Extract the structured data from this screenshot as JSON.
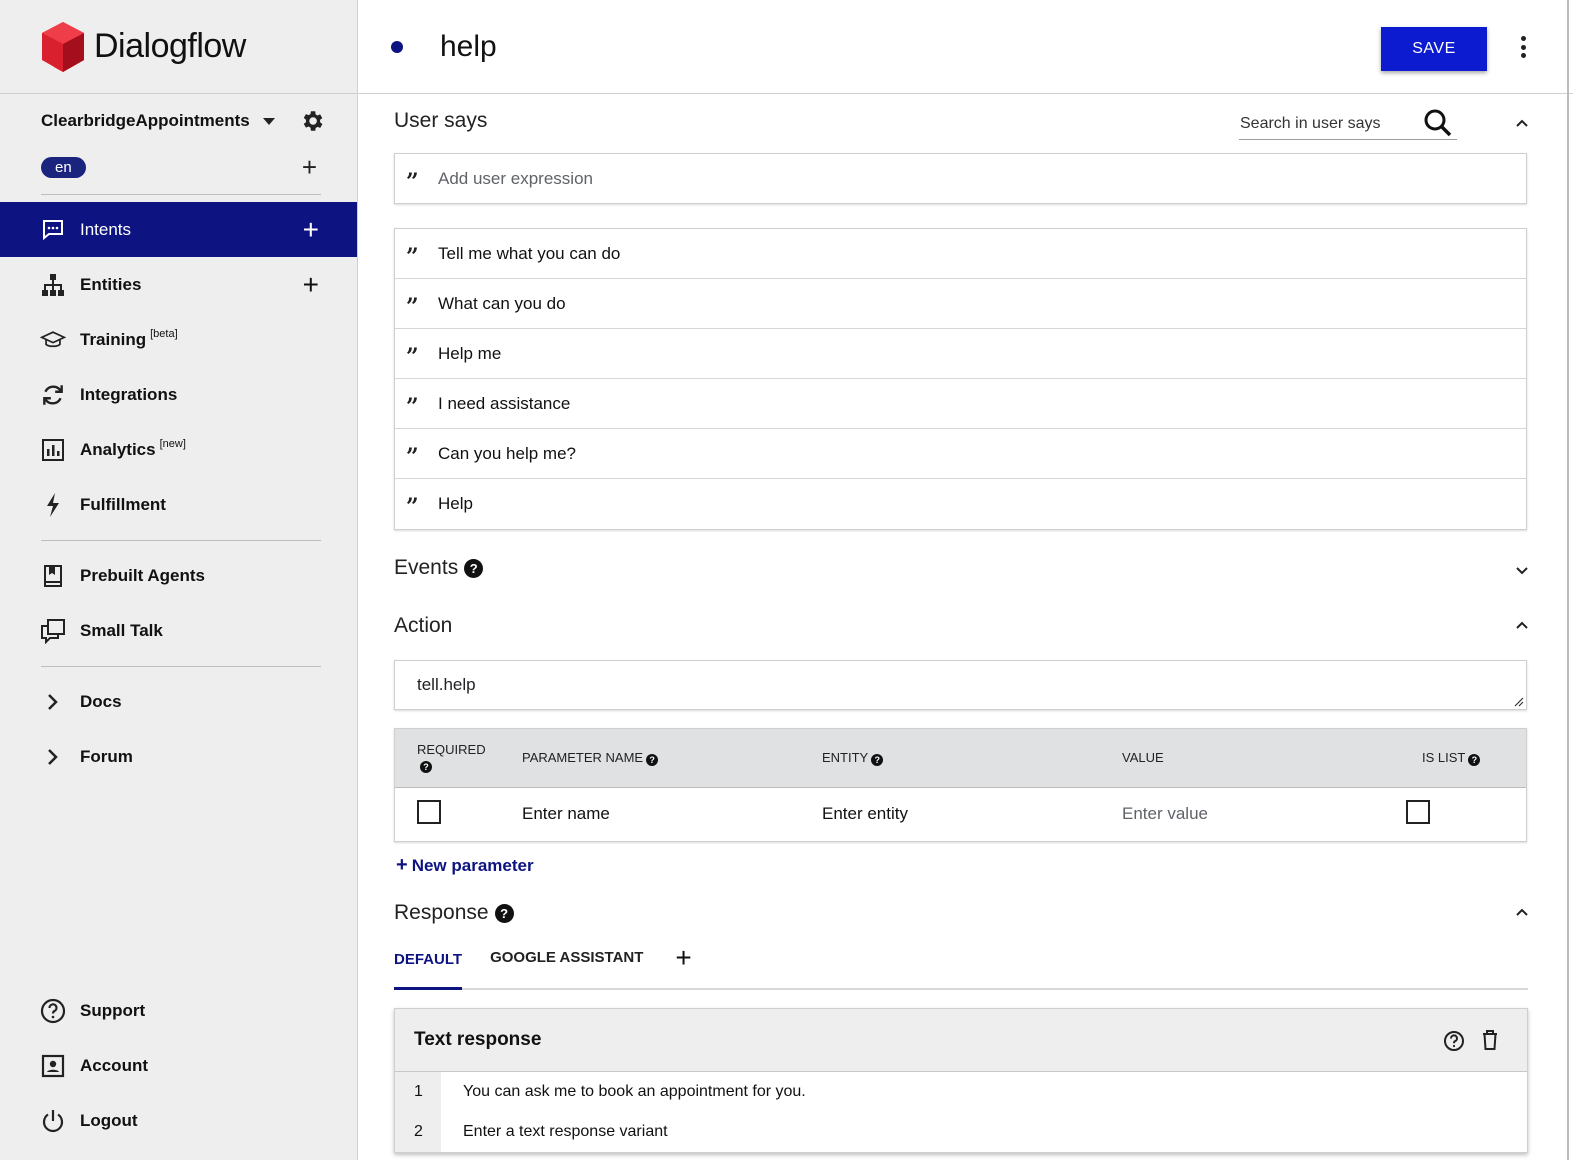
{
  "app": {
    "name": "Dialogflow"
  },
  "agent": {
    "name": "ClearbridgeAppointments",
    "language": "en"
  },
  "nav": {
    "items": [
      {
        "label": "Intents",
        "sup": "",
        "icon": "chat-bubble-icon"
      },
      {
        "label": "Entities",
        "sup": "",
        "icon": "hierarchy-icon"
      },
      {
        "label": "Training",
        "sup": "[beta]",
        "icon": "graduation-cap-icon"
      },
      {
        "label": "Integrations",
        "sup": "",
        "icon": "refresh-icon"
      },
      {
        "label": "Analytics",
        "sup": "[new]",
        "icon": "bar-chart-icon"
      },
      {
        "label": "Fulfillment",
        "sup": "",
        "icon": "bolt-icon"
      },
      {
        "label": "Prebuilt Agents",
        "sup": "",
        "icon": "book-icon"
      },
      {
        "label": "Small Talk",
        "sup": "",
        "icon": "chat-window-icon"
      },
      {
        "label": "Docs",
        "sup": "",
        "icon": "chevron-right-icon"
      },
      {
        "label": "Forum",
        "sup": "",
        "icon": "chevron-right-icon"
      }
    ],
    "bottom": [
      {
        "label": "Support",
        "icon": "help-circle-icon"
      },
      {
        "label": "Account",
        "icon": "account-box-icon"
      },
      {
        "label": "Logout",
        "icon": "power-icon"
      }
    ]
  },
  "header": {
    "intent_name": "help",
    "save_label": "SAVE"
  },
  "user_says": {
    "title": "User says",
    "search_placeholder": "Search in user says",
    "add_placeholder": "Add user expression",
    "phrases": [
      "Tell me what you can do",
      "What can you do",
      "Help me",
      "I need assistance",
      "Can you help me?",
      "Help"
    ]
  },
  "events": {
    "title": "Events"
  },
  "action": {
    "title": "Action",
    "value": "tell.help",
    "columns": [
      "REQUIRED",
      "PARAMETER NAME",
      "ENTITY",
      "VALUE",
      "IS LIST"
    ],
    "row": {
      "name_placeholder": "Enter name",
      "entity_placeholder": "Enter entity",
      "value_placeholder": "Enter value"
    },
    "new_param_label": "New parameter"
  },
  "response": {
    "title": "Response",
    "tabs": [
      "DEFAULT",
      "GOOGLE ASSISTANT"
    ],
    "card_title": "Text response",
    "rows": [
      {
        "num": "1",
        "text": "You can ask me to book an appointment for you."
      },
      {
        "num": "2",
        "text": "Enter a text response variant"
      }
    ]
  },
  "colors": {
    "accent": "#0d1482",
    "save_button": "#0d1bd0",
    "logo": "#c8102e"
  }
}
